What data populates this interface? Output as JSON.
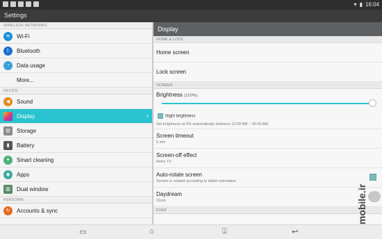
{
  "status_bar": {
    "time": "16:04"
  },
  "app_title": "Settings",
  "left_pane": {
    "sections": [
      {
        "label": "WIRELESS NETWORKS"
      },
      {
        "label": "DEVICE"
      },
      {
        "label": "PERSONAL"
      }
    ],
    "items": [
      {
        "label": "Wi-Fi",
        "icon": "wifi-icon"
      },
      {
        "label": "Bluetooth",
        "icon": "bluetooth-icon"
      },
      {
        "label": "Data usage",
        "icon": "data-usage-icon"
      },
      {
        "label": "More...",
        "icon": ""
      },
      {
        "label": "Sound",
        "icon": "sound-icon"
      },
      {
        "label": "Display",
        "icon": "display-icon"
      },
      {
        "label": "Storage",
        "icon": "storage-icon"
      },
      {
        "label": "Battery",
        "icon": "battery-icon"
      },
      {
        "label": "Smart cleaning",
        "icon": "smart-cleaning-icon"
      },
      {
        "label": "Apps",
        "icon": "apps-icon"
      },
      {
        "label": "Dual window",
        "icon": "dual-window-icon"
      },
      {
        "label": "Accounts & sync",
        "icon": "accounts-sync-icon"
      }
    ],
    "selected": "Display"
  },
  "right_pane": {
    "header": "Display",
    "sections": [
      {
        "label": "HOME & LOCK"
      },
      {
        "label": "SCREEN"
      },
      {
        "label": "FONT"
      }
    ],
    "home_screen": "Home screen",
    "lock_screen": "Lock screen",
    "brightness": {
      "title": "Brightness",
      "percent": "(100%)",
      "value": 100,
      "night_label": "Night brightness",
      "night_checked": true,
      "summary": "Set brightness at 0% automatically between 12:00 AM ~ 06:00 AM"
    },
    "screen_timeout": {
      "title": "Screen timeout",
      "summary": "5 min"
    },
    "screen_off_effect": {
      "title": "Screen-off effect",
      "summary": "Retro TV"
    },
    "auto_rotate": {
      "title": "Auto-rotate screen",
      "summary": "Screen is rotated according to tablet orientation",
      "checked": true
    },
    "daydream": {
      "title": "Daydream",
      "summary": "Clock"
    }
  },
  "watermark": "mobile.ir",
  "colors": {
    "accent": "#2ac3d0",
    "header": "#5d6163"
  }
}
